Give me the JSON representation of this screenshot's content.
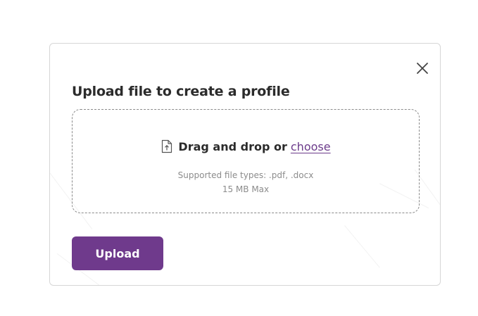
{
  "modal": {
    "title": "Upload file to create a profile",
    "close_icon": "close-icon",
    "dropzone": {
      "icon": "file-upload-icon",
      "prompt": "Drag and drop or",
      "choose_label": "choose",
      "supported_types": "Supported file types: .pdf, .docx",
      "max_size": "15 MB Max"
    },
    "upload_label": "Upload"
  },
  "colors": {
    "accent": "#6f3a8c",
    "link": "#6b3a8a",
    "title": "#2b2b2b",
    "hint": "#8c8c8c",
    "border": "#d6d6d6"
  }
}
